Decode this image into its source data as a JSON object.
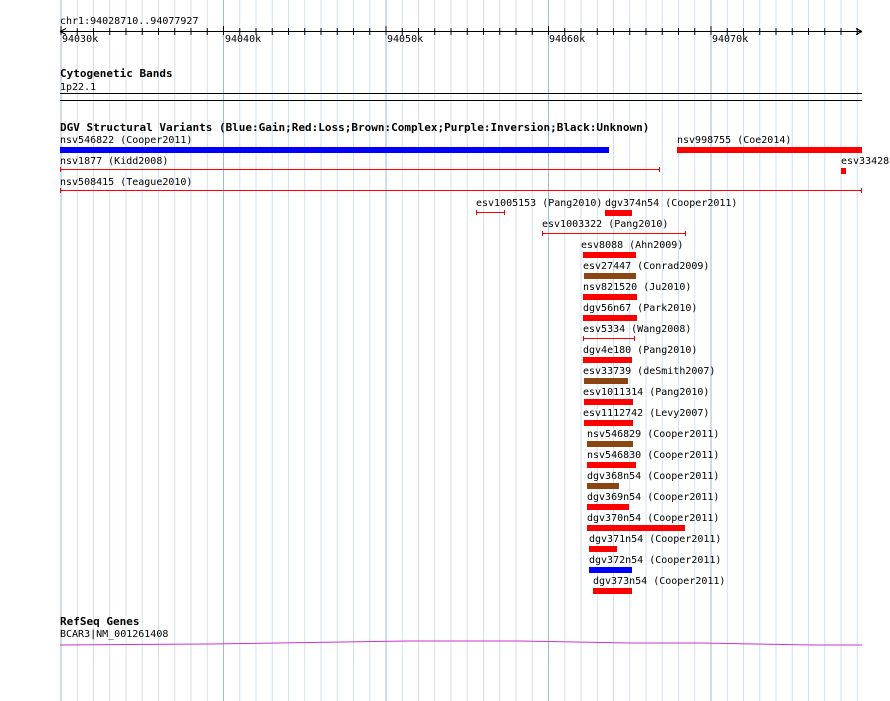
{
  "ruler": {
    "coordinate": "chr1:94028710..94077927",
    "ticks": [
      "94030k",
      "94040k",
      "94050k",
      "94060k",
      "94070k"
    ]
  },
  "cytoband": {
    "title": "Cytogenetic Bands",
    "band": "1p22.1"
  },
  "dgv": {
    "title": "DGV Structural Variants (Blue:Gain;Red:Loss;Brown:Complex;Purple:Inversion;Black:Unknown)",
    "colors": {
      "gain": "#0000ff",
      "loss": "#ff0000",
      "complex": "#8b4513"
    },
    "features": [
      {
        "label": "nsv546822 (Cooper2011)",
        "type": "gain",
        "style": "bar"
      },
      {
        "label": "nsv998755 (Coe2014)",
        "type": "loss",
        "style": "bar"
      },
      {
        "label": "nsv1877 (Kidd2008)",
        "type": "loss",
        "style": "line"
      },
      {
        "label": "esv33428",
        "type": "loss",
        "style": "bar"
      },
      {
        "label": "nsv508415 (Teague2010)",
        "type": "loss",
        "style": "line"
      },
      {
        "label": "esv1005153 (Pang2010)",
        "type": "loss",
        "style": "line"
      },
      {
        "label": "dgv374n54 (Cooper2011)",
        "type": "loss",
        "style": "bar"
      },
      {
        "label": "esv1003322 (Pang2010)",
        "type": "loss",
        "style": "line"
      },
      {
        "label": "esv8088 (Ahn2009)",
        "type": "loss",
        "style": "bar"
      },
      {
        "label": "esv27447 (Conrad2009)",
        "type": "complex",
        "style": "bar"
      },
      {
        "label": "nsv821520 (Ju2010)",
        "type": "loss",
        "style": "bar"
      },
      {
        "label": "dgv56n67 (Park2010)",
        "type": "loss",
        "style": "bar"
      },
      {
        "label": "esv5334 (Wang2008)",
        "type": "loss",
        "style": "line"
      },
      {
        "label": "dgv4e180 (Pang2010)",
        "type": "loss",
        "style": "bar"
      },
      {
        "label": "esv33739 (deSmith2007)",
        "type": "complex",
        "style": "bar"
      },
      {
        "label": "esv1011314 (Pang2010)",
        "type": "loss",
        "style": "bar"
      },
      {
        "label": "esv1112742 (Levy2007)",
        "type": "loss",
        "style": "bar"
      },
      {
        "label": "nsv546829 (Cooper2011)",
        "type": "complex",
        "style": "bar"
      },
      {
        "label": "nsv546830 (Cooper2011)",
        "type": "loss",
        "style": "bar"
      },
      {
        "label": "dgv368n54 (Cooper2011)",
        "type": "complex",
        "style": "bar"
      },
      {
        "label": "dgv369n54 (Cooper2011)",
        "type": "loss",
        "style": "bar"
      },
      {
        "label": "dgv370n54 (Cooper2011)",
        "type": "loss",
        "style": "bar"
      },
      {
        "label": "dgv371n54 (Cooper2011)",
        "type": "loss",
        "style": "bar"
      },
      {
        "label": "dgv372n54 (Cooper2011)",
        "type": "gain",
        "style": "bar"
      },
      {
        "label": "dgv373n54 (Cooper2011)",
        "type": "loss",
        "style": "bar"
      }
    ]
  },
  "refseq": {
    "title": "RefSeq Genes",
    "gene": "BCAR3|NM_001261408",
    "color": "#cc33cc"
  }
}
